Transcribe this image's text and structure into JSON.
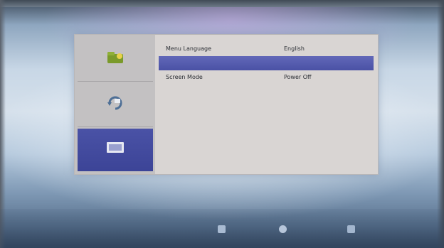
{
  "sidebar": {
    "items": [
      {
        "label": "",
        "icon": "folder-icon",
        "selected": false
      },
      {
        "label": "",
        "icon": "cycle-icon",
        "selected": false
      },
      {
        "label": "",
        "icon": "screen-icon",
        "selected": true
      }
    ]
  },
  "menu": {
    "rows": [
      {
        "label": "Menu Language",
        "value": "English",
        "selected": false
      },
      {
        "label": "",
        "value": "",
        "selected": true
      },
      {
        "label": "Screen Mode",
        "value": "Power Off",
        "selected": false
      },
      {
        "label": "",
        "value": "",
        "selected": false
      },
      {
        "label": "",
        "value": "",
        "selected": false
      },
      {
        "label": "",
        "value": "",
        "selected": false
      },
      {
        "label": "",
        "value": "",
        "selected": false
      }
    ]
  },
  "footer": {
    "hints": [
      {
        "label": "",
        "icon": "key-icon"
      },
      {
        "label": "",
        "icon": "key-icon"
      },
      {
        "label": "",
        "icon": "key-icon"
      }
    ]
  },
  "colors": {
    "highlight": "#4a51a5",
    "panel": "#d9d5d3",
    "sidebar": "#c3c1c2"
  }
}
